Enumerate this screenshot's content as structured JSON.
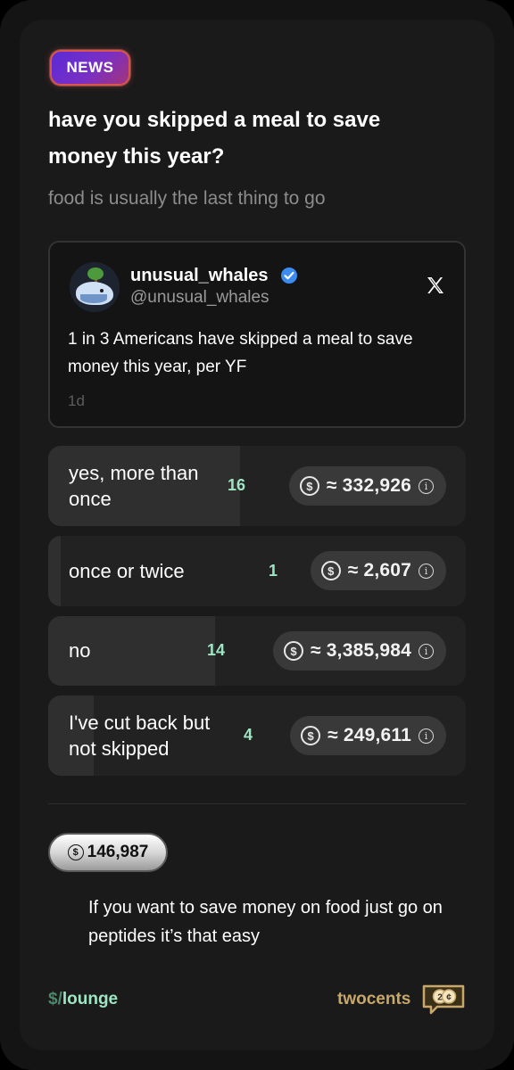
{
  "post": {
    "badge": "NEWS",
    "title": "have you skipped a meal to save money this year?",
    "subtitle": "food is usually the last thing to go"
  },
  "tweet": {
    "name": "unusual_whales",
    "handle": "@unusual_whales",
    "text": "1 in 3 Americans have skipped a meal to save money this year, per YF",
    "time": "1d",
    "avatar_icon": "whale-avatar",
    "verified_icon": "verified-badge-icon",
    "platform_icon": "x-logo-icon"
  },
  "poll": {
    "options": [
      {
        "label": "yes, more than once",
        "count": "16",
        "amount": "≈ 332,926",
        "fill": 0.46
      },
      {
        "label": "once or twice",
        "count": "1",
        "amount": "≈ 2,607",
        "fill": 0.03
      },
      {
        "label": "no",
        "count": "14",
        "amount": "≈ 3,385,984",
        "fill": 0.4
      },
      {
        "label": "I've cut back but not skipped",
        "count": "4",
        "amount": "≈ 249,611",
        "fill": 0.11
      }
    ],
    "coin_symbol": "$",
    "info_symbol": "i"
  },
  "comment": {
    "amount": "146,987",
    "coin_symbol": "$",
    "text": "If you want to save money on food just go on peptides it’s that easy"
  },
  "footer": {
    "channel_prefix": "$/",
    "channel_name": "lounge",
    "brand": "twocents"
  },
  "colors": {
    "accent_green": "#9ee6c3",
    "brand_gold": "#c7a76a",
    "badge_purple": "#5b2bd6"
  }
}
